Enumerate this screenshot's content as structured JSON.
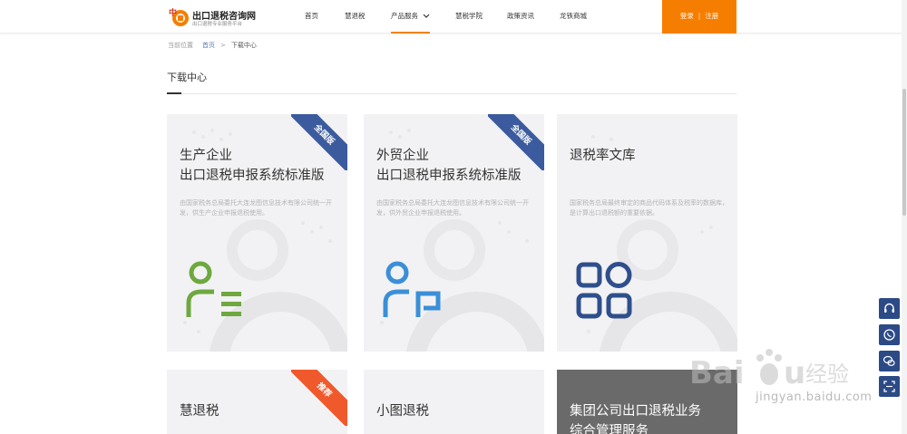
{
  "brand": {
    "title": "出口退税咨询网",
    "subtitle": "出口退税专业服务平台",
    "primary_color": "#f57e00",
    "accent_blue": "#2c4a86"
  },
  "nav": {
    "items": [
      {
        "label": "首页"
      },
      {
        "label": "慧退税"
      },
      {
        "label": "产品服务",
        "active": true,
        "has_dropdown": true
      },
      {
        "label": "慧税学院"
      },
      {
        "label": "政策资讯"
      },
      {
        "label": "龙铁商城"
      }
    ],
    "login_label": "登录",
    "separator": "|",
    "register_label": "注册"
  },
  "breadcrumb": {
    "prefix": "当前位置",
    "home": "首页",
    "separator": ">",
    "current": "下载中心"
  },
  "page_title": "下载中心",
  "cards": [
    {
      "title_line1": "生产企业",
      "title_line2": "出口退税申报系统标准版",
      "desc": "由国家税务总局委托大连龙图信息技术有限公司统一开发，供生产企业申报退税使用。",
      "ribbon": "全国版",
      "ribbon_color": "#3b5b9e",
      "icon": "user-list-icon",
      "icon_color": "#6ea83f"
    },
    {
      "title_line1": "外贸企业",
      "title_line2": "出口退税申报系统标准版",
      "desc": "由国家税务总局委托大连龙图信息技术有限公司统一开发，供外贸企业申报退税使用。",
      "ribbon": "全国版",
      "ribbon_color": "#3b5b9e",
      "icon": "user-doc-icon",
      "icon_color": "#3a8fd8"
    },
    {
      "title_line1": "退税率文库",
      "title_line2": "",
      "desc": "国家税务总局最终审定的商品代码体系及税率的数据库，是计算出口退税额的重要依据。",
      "ribbon": "",
      "icon": "grid-apps-icon",
      "icon_color": "#2f4f8c"
    },
    {
      "title_line1": "慧退税",
      "title_line2": "",
      "desc": "",
      "ribbon": "推荐",
      "ribbon_color": "#f0592b"
    },
    {
      "title_line1": "小图退税",
      "title_line2": "",
      "desc": "",
      "ribbon": ""
    },
    {
      "title_line1": "集团公司出口退税业务",
      "title_line2": "综合管理服务",
      "desc": "",
      "ribbon": ""
    }
  ],
  "side_tools": [
    "headset-icon",
    "whatsapp-icon",
    "chat-icon",
    "scan-icon"
  ],
  "watermark": {
    "text": "jingyan.baidu.com"
  }
}
